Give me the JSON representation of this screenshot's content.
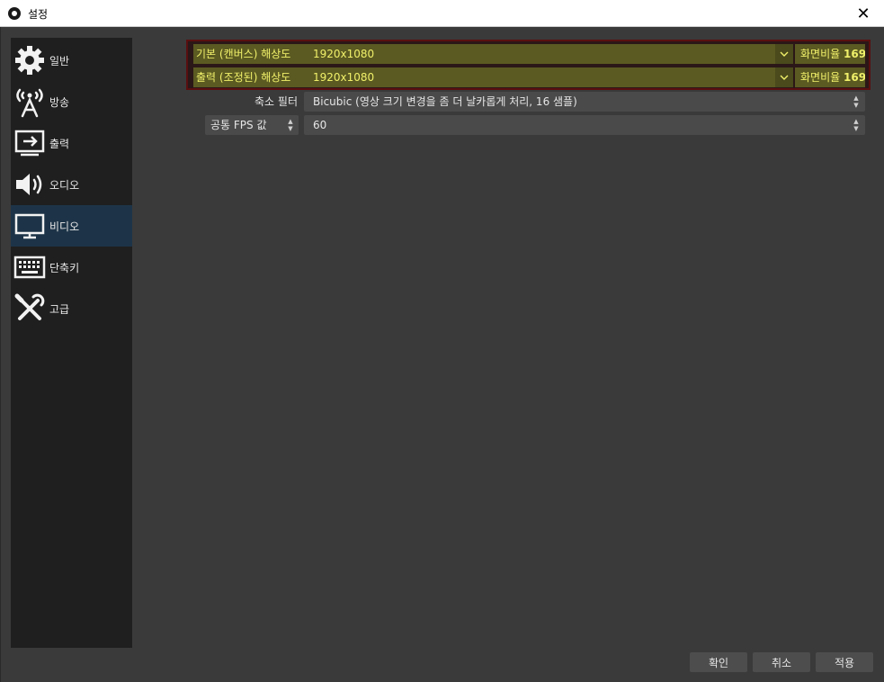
{
  "window": {
    "title": "설정",
    "close_glyph": "✕"
  },
  "sidebar": {
    "items": [
      {
        "label": "일반",
        "icon": "gear-icon"
      },
      {
        "label": "방송",
        "icon": "broadcast-antenna-icon"
      },
      {
        "label": "출력",
        "icon": "output-arrow-icon"
      },
      {
        "label": "오디오",
        "icon": "speaker-icon"
      },
      {
        "label": "비디오",
        "icon": "monitor-icon",
        "active": true
      },
      {
        "label": "단축키",
        "icon": "keyboard-icon"
      },
      {
        "label": "고급",
        "icon": "tools-icon"
      }
    ]
  },
  "video": {
    "base_resolution": {
      "label": "기본 (캔버스) 해상도",
      "value": "1920x1080",
      "aspect_label": "화면비율",
      "aspect_value": "169"
    },
    "output_resolution": {
      "label": "출력 (조정된) 해상도",
      "value": "1920x1080",
      "aspect_label": "화면비율",
      "aspect_value": "169"
    },
    "downscale_filter": {
      "label": "축소 필터",
      "value": "Bicubic (영상 크기 변경을 좀 더 날카롭게 처리, 16 샘플)"
    },
    "fps": {
      "label": "공통 FPS 값",
      "value": "60"
    }
  },
  "buttons": {
    "ok": "확인",
    "cancel": "취소",
    "apply": "적용"
  },
  "colors": {
    "highlight_text": "#f0f06a",
    "highlight_border": "#5a0f0f",
    "active_item": "#1d3448"
  }
}
